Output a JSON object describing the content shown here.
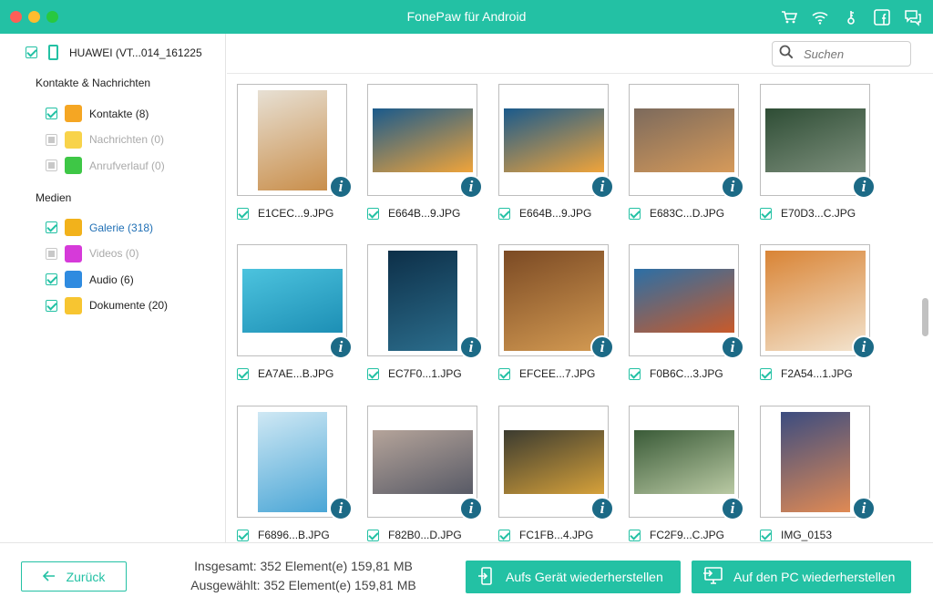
{
  "window": {
    "title": "FonePaw für Android"
  },
  "titlebar": {
    "icons": [
      "cart-icon",
      "wifi-icon",
      "key-icon",
      "facebook-icon",
      "feedback-icon"
    ]
  },
  "sidebar": {
    "device": {
      "label": "HUAWEI (VT...014_161225",
      "checked": true
    },
    "section_contacts": "Kontakte & Nachrichten",
    "section_media": "Medien",
    "contacts_items": [
      {
        "label": "Kontakte (8)",
        "checked": true,
        "state": "normal",
        "icon": "contacts-icon",
        "color": "#f5a623"
      },
      {
        "label": "Nachrichten (0)",
        "checked": false,
        "state": "disabled",
        "icon": "messages-icon",
        "color": "#f8d34a"
      },
      {
        "label": "Anrufverlauf (0)",
        "checked": false,
        "state": "disabled",
        "icon": "call-log-icon",
        "color": "#3ec746"
      }
    ],
    "media_items": [
      {
        "label": "Galerie (318)",
        "checked": true,
        "state": "active",
        "icon": "gallery-icon",
        "color": "#f2b21b"
      },
      {
        "label": "Videos (0)",
        "checked": false,
        "state": "disabled",
        "icon": "videos-icon",
        "color": "#d63ad9"
      },
      {
        "label": "Audio (6)",
        "checked": true,
        "state": "normal",
        "icon": "audio-icon",
        "color": "#2f8be0"
      },
      {
        "label": "Dokumente (20)",
        "checked": true,
        "state": "normal",
        "icon": "documents-icon",
        "color": "#f7c531"
      }
    ]
  },
  "search": {
    "placeholder": "Suchen"
  },
  "gallery": [
    {
      "name": "E1CEC...9.JPG",
      "checked": true,
      "colors": [
        "#e7e0d4",
        "#c98e4a"
      ],
      "shape": "portrait"
    },
    {
      "name": "E664B...9.JPG",
      "checked": true,
      "colors": [
        "#1a5a8c",
        "#f0a43a"
      ],
      "shape": "landscape"
    },
    {
      "name": "E664B...9.JPG",
      "checked": true,
      "colors": [
        "#1a5a8c",
        "#f0a43a"
      ],
      "shape": "landscape"
    },
    {
      "name": "E683C...D.JPG",
      "checked": true,
      "colors": [
        "#7c6a5c",
        "#d69a5a"
      ],
      "shape": "landscape"
    },
    {
      "name": "E70D3...C.JPG",
      "checked": true,
      "colors": [
        "#2e4d35",
        "#7d8f7c"
      ],
      "shape": "landscape"
    },
    {
      "name": "EA7AE...B.JPG",
      "checked": true,
      "colors": [
        "#4cc3de",
        "#1d8fb5"
      ],
      "shape": "landscape"
    },
    {
      "name": "EC7F0...1.JPG",
      "checked": true,
      "colors": [
        "#0d2f48",
        "#2b6d8c"
      ],
      "shape": "portrait"
    },
    {
      "name": "EFCEE...7.JPG",
      "checked": true,
      "colors": [
        "#7b4a24",
        "#d39a52"
      ],
      "shape": "square"
    },
    {
      "name": "F0B6C...3.JPG",
      "checked": true,
      "colors": [
        "#2b6fa6",
        "#c95a2a"
      ],
      "shape": "landscape"
    },
    {
      "name": "F2A54...1.JPG",
      "checked": true,
      "colors": [
        "#d98435",
        "#f3e4cf"
      ],
      "shape": "square"
    },
    {
      "name": "F6896...B.JPG",
      "checked": true,
      "colors": [
        "#cfe8f4",
        "#4aa6d6"
      ],
      "shape": "portrait"
    },
    {
      "name": "F82B0...D.JPG",
      "checked": true,
      "colors": [
        "#b5a49a",
        "#585a66"
      ],
      "shape": "landscape"
    },
    {
      "name": "FC1FB...4.JPG",
      "checked": true,
      "colors": [
        "#3b3b30",
        "#d6a13a"
      ],
      "shape": "landscape"
    },
    {
      "name": "FC2F9...C.JPG",
      "checked": true,
      "colors": [
        "#3a5b38",
        "#b9c9a3"
      ],
      "shape": "landscape"
    },
    {
      "name": "IMG_0153",
      "checked": true,
      "colors": [
        "#3b4c80",
        "#e08a54"
      ],
      "shape": "portrait"
    }
  ],
  "footer": {
    "back_label": "Zurück",
    "total_line": "Insgesamt: 352 Element(e) 159,81 MB",
    "selected_line": "Ausgewählt: 352 Element(e) 159,81 MB",
    "restore_device_label": "Aufs Gerät wiederherstellen",
    "restore_pc_label": "Auf den PC wiederherstellen"
  },
  "colors": {
    "accent": "#23c1a4",
    "info": "#1c6a86",
    "link": "#1f6fb5"
  }
}
